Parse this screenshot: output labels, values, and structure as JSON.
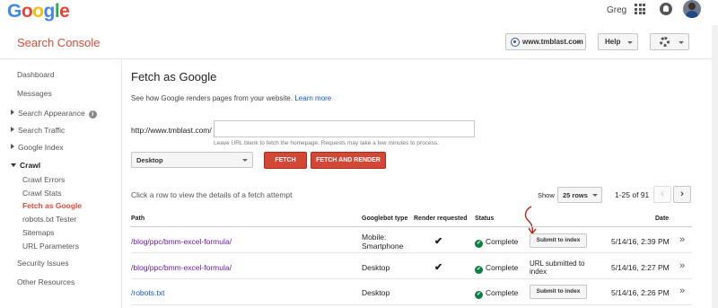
{
  "google_logo": {
    "letters": [
      {
        "ch": "G",
        "color": "#4285f4"
      },
      {
        "ch": "o",
        "color": "#ea4335"
      },
      {
        "ch": "o",
        "color": "#fbbc05"
      },
      {
        "ch": "g",
        "color": "#4285f4"
      },
      {
        "ch": "l",
        "color": "#34a853"
      },
      {
        "ch": "e",
        "color": "#ea4335"
      }
    ]
  },
  "topbar": {
    "user_name": "Greg",
    "apps_icon": "apps-grid-icon",
    "notifications_icon": "bell-icon"
  },
  "header": {
    "product_title": "Search Console",
    "site_selector": "www.tmblast.com",
    "help_label": "Help",
    "settings_icon": "gear-icon"
  },
  "sidebar": {
    "items": [
      {
        "label": "Dashboard"
      },
      {
        "label": "Messages"
      },
      {
        "label": "Search Appearance"
      },
      {
        "label": "Search Traffic"
      },
      {
        "label": "Google Index"
      },
      {
        "label": "Crawl"
      },
      {
        "label": "Crawl Errors"
      },
      {
        "label": "Crawl Stats"
      },
      {
        "label": "Fetch as Google"
      },
      {
        "label": "robots.txt Tester"
      },
      {
        "label": "Sitemaps"
      },
      {
        "label": "URL Parameters"
      },
      {
        "label": "Security Issues"
      },
      {
        "label": "Other Resources"
      }
    ]
  },
  "main": {
    "title": "Fetch as Google",
    "description": "See how Google renders pages from your website.",
    "learn_more": "Learn more",
    "url_prefix": "http://www.tmblast.com/",
    "url_value": "",
    "url_hint": "Leave URL blank to fetch the homepage. Requests may take a few minutes to process.",
    "device": "Desktop",
    "fetch_label": "FETCH",
    "fetch_render_label": "FETCH AND RENDER",
    "table_hint": "Click a row to view the details of a fetch attempt",
    "show_label": "Show",
    "rows_option": "25 rows",
    "range_label": "1-25 of 91",
    "prev_icon": "‹",
    "next_icon": "›"
  },
  "table": {
    "headers": {
      "path": "Path",
      "type": "Googlebot type",
      "render": "Render requested",
      "status": "Status",
      "date": "Date"
    },
    "rows": [
      {
        "path": "/blog/ppc/bmm-excel-formula/",
        "type_line1": "Mobile:",
        "type_line2": "Smartphone",
        "render": "✔",
        "status": "Complete",
        "action": "Submit to index",
        "date": "5/14/16, 2:39 PM",
        "arrow": "»"
      },
      {
        "path": "/blog/ppc/bmm-excel-formula/",
        "type_line1": "Desktop",
        "render": "✔",
        "status": "Complete",
        "submitted_line1": "URL submitted to",
        "submitted_line2": "index",
        "date": "5/14/16, 2:27 PM",
        "arrow": "»"
      },
      {
        "path": "/robots.txt",
        "type_line1": "Desktop",
        "render": "",
        "status": "Complete",
        "action": "Submit to index",
        "date": "5/14/16, 2:26 PM",
        "arrow": "»"
      }
    ]
  }
}
